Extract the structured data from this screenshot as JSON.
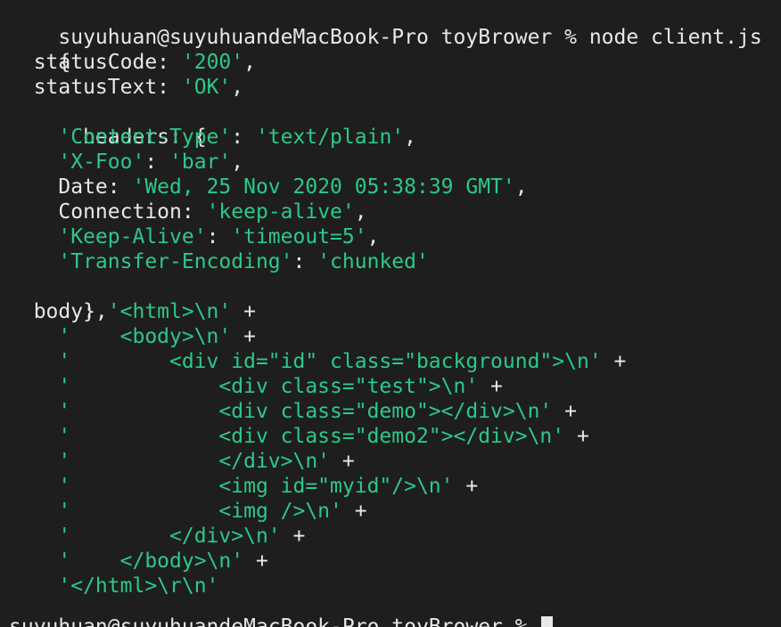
{
  "terminal": {
    "prompt": "suyuhuan@suyuhuandeMacBook-Pro toyBrower % node client.js",
    "next_prompt": "suyuhuan@suyuhuandeMacBook-Pro toyBrower % ",
    "colors": {
      "background": "#1e1e1e",
      "text": "#e8e8e8",
      "string": "#2bc98a"
    },
    "output": {
      "open_brace": "{",
      "status_code": {
        "key": "  statusCode: ",
        "value": "'200'",
        "tail": ","
      },
      "status_text": {
        "key": "  statusText: ",
        "value": "'OK'",
        "tail": ","
      },
      "headers_open": "  headers: {",
      "headers": [
        {
          "indent": "    ",
          "key": "'Content-Type'",
          "sep": ": ",
          "value": "'text/plain'",
          "tail": ","
        },
        {
          "indent": "    ",
          "key": "'X-Foo'",
          "sep": ": ",
          "value": "'bar'",
          "tail": ","
        },
        {
          "indent": "    ",
          "plain_key": "Date",
          "sep": ": ",
          "value": "'Wed, 25 Nov 2020 05:38:39 GMT'",
          "tail": ","
        },
        {
          "indent": "    ",
          "plain_key": "Connection",
          "sep": ": ",
          "value": "'keep-alive'",
          "tail": ","
        },
        {
          "indent": "    ",
          "key": "'Keep-Alive'",
          "sep": ": ",
          "value": "'timeout=5'",
          "tail": ","
        },
        {
          "indent": "    ",
          "key": "'Transfer-Encoding'",
          "sep": ": ",
          "value": "'chunked'",
          "tail": ""
        }
      ],
      "headers_close": "  },",
      "body_key": "  body: ",
      "body_lines": [
        {
          "prefix": "",
          "value": "'<html>\\n'",
          "tail": " +"
        },
        {
          "prefix": "    ",
          "value": "'    <body>\\n'",
          "tail": " +"
        },
        {
          "prefix": "    ",
          "value": "'        <div id=\"id\" class=\"background\">\\n'",
          "tail": " +"
        },
        {
          "prefix": "    ",
          "value": "'            <div class=\"test\">\\n'",
          "tail": " +"
        },
        {
          "prefix": "    ",
          "value": "'            <div class=\"demo\"></div>\\n'",
          "tail": " +"
        },
        {
          "prefix": "    ",
          "value": "'            <div class=\"demo2\"></div>\\n'",
          "tail": " +"
        },
        {
          "prefix": "    ",
          "value": "'            </div>\\n'",
          "tail": " +"
        },
        {
          "prefix": "    ",
          "value": "'            <img id=\"myid\"/>\\n'",
          "tail": " +"
        },
        {
          "prefix": "    ",
          "value": "'            <img />\\n'",
          "tail": " +"
        },
        {
          "prefix": "    ",
          "value": "'        </div>\\n'",
          "tail": " +"
        },
        {
          "prefix": "    ",
          "value": "'    </body>\\n'",
          "tail": " +"
        },
        {
          "prefix": "    ",
          "value": "'</html>\\r\\n'",
          "tail": ""
        }
      ],
      "close_brace": "}"
    }
  }
}
